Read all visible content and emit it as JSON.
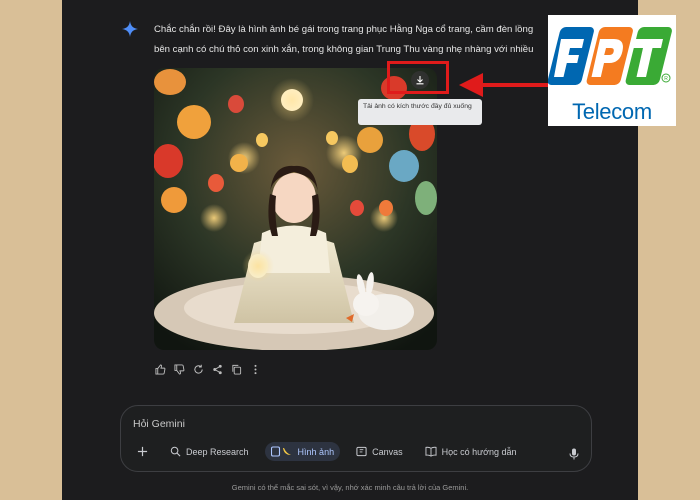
{
  "response": {
    "text": "Chắc chắn rồi! Đây là hình ảnh bé gái trong trang phục Hằng Nga cổ trang, cầm đèn lồng\nbên cạnh có chú thỏ con xinh xắn, trong không gian Trung Thu vàng nhẹ nhàng với nhiều"
  },
  "image": {
    "tooltip": "Tải ảnh có kích thước đầy đủ xuống"
  },
  "input": {
    "placeholder": "Hỏi Gemini"
  },
  "toolbar": {
    "tools": [
      {
        "label": "Deep Research",
        "icon": "deep-research-icon"
      },
      {
        "label": "Hình ảnh",
        "icon": "image-banana-icon",
        "active": true
      },
      {
        "label": "Canvas",
        "icon": "canvas-icon"
      },
      {
        "label": "Học có hướng dẫn",
        "icon": "book-icon"
      }
    ]
  },
  "footer": {
    "disclaimer": "Gemini có thể mắc sai sót, vì vậy, nhớ xác minh câu trả lời của Gemini."
  },
  "logo": {
    "letters": "FPT",
    "text": "Telecom",
    "colors": {
      "f": "#0067b1",
      "p": "#f47b20",
      "t": "#3aaa35"
    }
  },
  "colors": {
    "highlight": "#e01b1b",
    "background": "#1c1c1e",
    "accent": "#aec7ff"
  }
}
